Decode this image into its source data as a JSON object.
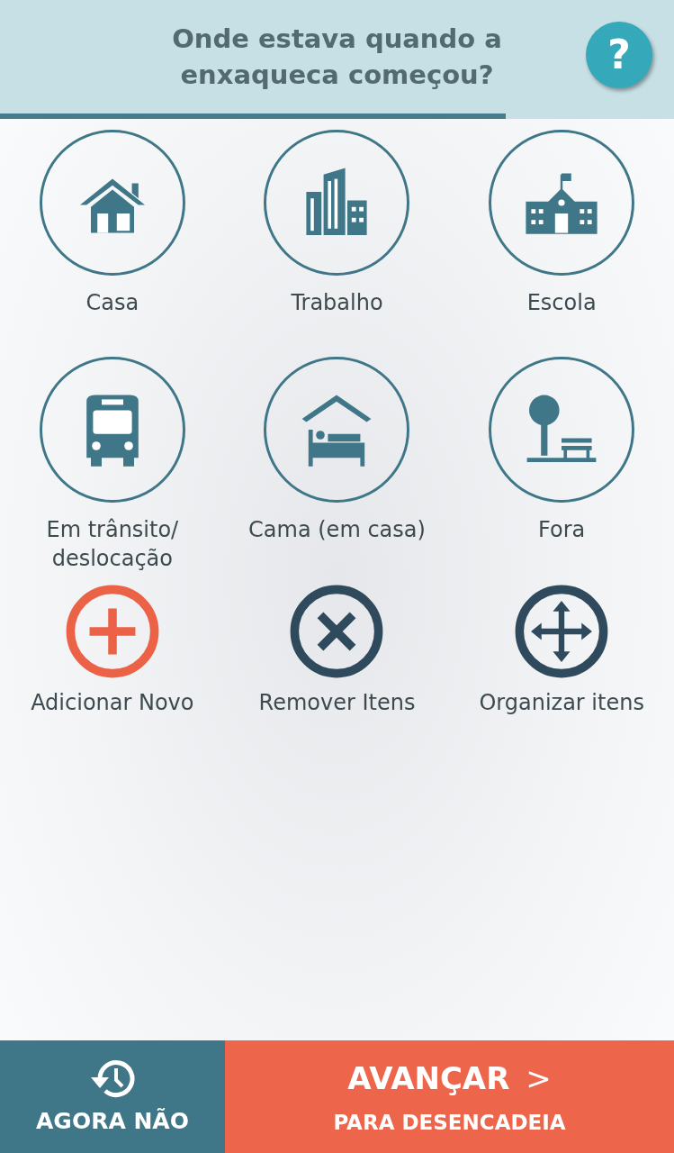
{
  "header": {
    "title": "Onde estava quando a enxaqueca começou?",
    "help": "?",
    "progress": {
      "level": 0.75
    }
  },
  "places": [
    {
      "kind": "house",
      "label": "Casa"
    },
    {
      "kind": "office",
      "label": "Trabalho"
    },
    {
      "kind": "school",
      "label": "Escola"
    },
    {
      "kind": "bus",
      "label": "Em trânsito/ deslocação"
    },
    {
      "kind": "bed",
      "label": "Cama (em casa)"
    },
    {
      "kind": "park",
      "label": "Fora"
    }
  ],
  "actions": [
    {
      "kind": "add",
      "label": "Adicionar Novo"
    },
    {
      "kind": "remove",
      "label": "Remover Itens"
    },
    {
      "kind": "organize",
      "label": "Organizar itens"
    }
  ],
  "footer": {
    "skip": {
      "label": "AGORA NÃO"
    },
    "next": {
      "label": "AVANÇAR",
      "sublabel": "PARA DESENCADEIA",
      "arrow": ">"
    }
  }
}
